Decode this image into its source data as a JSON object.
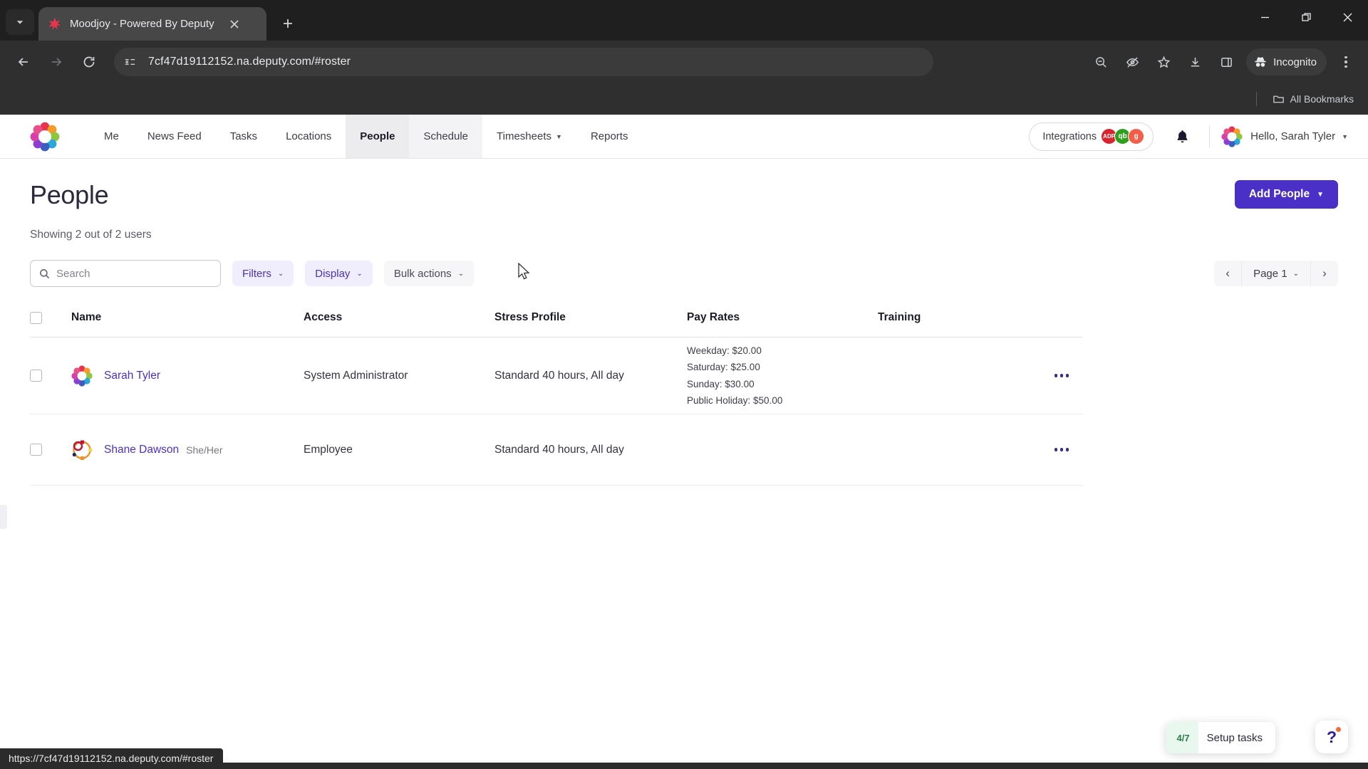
{
  "browser": {
    "tab": {
      "title": "Moodjoy - Powered By Deputy",
      "favicon": "deputy-logo"
    },
    "new_tab_label": "+",
    "url": "7cf47d19112152.na.deputy.com/#roster",
    "status_url": "https://7cf47d19112152.na.deputy.com/#roster",
    "incognito_label": "Incognito",
    "bookmarks_label": "All Bookmarks",
    "icons": {
      "tab_search": "chevron-down-icon",
      "back": "back-arrow-icon",
      "forward": "forward-arrow-icon",
      "reload": "reload-icon",
      "site_info": "site-settings-icon",
      "zoom": "zoom-out-icon",
      "tracking": "eye-off-icon",
      "bookmark": "star-icon",
      "download": "download-icon",
      "side_panel": "side-panel-icon",
      "menu": "three-dot-menu-icon",
      "minimize": "minimize-icon",
      "maximize": "maximize-icon",
      "close": "close-icon"
    }
  },
  "appnav": {
    "logo": "deputy-logo",
    "links": [
      {
        "label": "Me",
        "state": "normal"
      },
      {
        "label": "News Feed",
        "state": "normal"
      },
      {
        "label": "Tasks",
        "state": "normal"
      },
      {
        "label": "Locations",
        "state": "normal"
      },
      {
        "label": "People",
        "state": "active"
      },
      {
        "label": "Schedule",
        "state": "hover"
      },
      {
        "label": "Timesheets",
        "state": "dropdown"
      },
      {
        "label": "Reports",
        "state": "normal"
      }
    ],
    "integrations": {
      "label": "Integrations",
      "badges": [
        {
          "name": "adp",
          "text": "ADP",
          "color": "#d9232e"
        },
        {
          "name": "quickbooks",
          "text": "qb",
          "color": "#2ca01c"
        },
        {
          "name": "gusto",
          "text": "g",
          "color": "#f45d48"
        }
      ]
    },
    "notifications_icon": "bell-icon",
    "user": {
      "greeting": "Hello, Sarah Tyler",
      "avatar": "deputy-avatar"
    }
  },
  "main": {
    "title": "People",
    "subtitle": "Showing 2 out of 2 users",
    "add_button": {
      "label": "Add People",
      "caret": "▼",
      "color": "#4a30c7"
    },
    "search": {
      "placeholder": "Search",
      "value": "",
      "icon": "search-icon"
    },
    "buttons": [
      {
        "label": "Filters",
        "style": "accent",
        "caret": "⌄"
      },
      {
        "label": "Display",
        "style": "accent",
        "caret": "⌄"
      },
      {
        "label": "Bulk actions",
        "style": "plain",
        "caret": "⌄"
      }
    ],
    "pagination": {
      "prev": "‹",
      "page_label": "Page 1",
      "caret": "⌄",
      "next": "›"
    },
    "table": {
      "columns": [
        "Name",
        "Access",
        "Stress Profile",
        "Pay Rates",
        "Training"
      ],
      "rows": [
        {
          "name": "Sarah Tyler",
          "pronouns": "",
          "access": "System Administrator",
          "stress_profile": "Standard 40 hours, All day",
          "pay_rates": [
            "Weekday: $20.00",
            "Saturday: $25.00",
            "Sunday: $30.00",
            "Public Holiday: $50.00"
          ],
          "training": "",
          "actions_icon": "row-actions-icon"
        },
        {
          "name": "Shane Dawson",
          "pronouns": "She/Her",
          "access": "Employee",
          "stress_profile": "Standard 40 hours, All day",
          "pay_rates": [],
          "training": "",
          "actions_icon": "row-actions-icon"
        }
      ]
    }
  },
  "widgets": {
    "setup_tasks": {
      "badge": "4/7",
      "label": "Setup tasks"
    },
    "help": {
      "glyph": "?",
      "name": "help-button"
    }
  }
}
